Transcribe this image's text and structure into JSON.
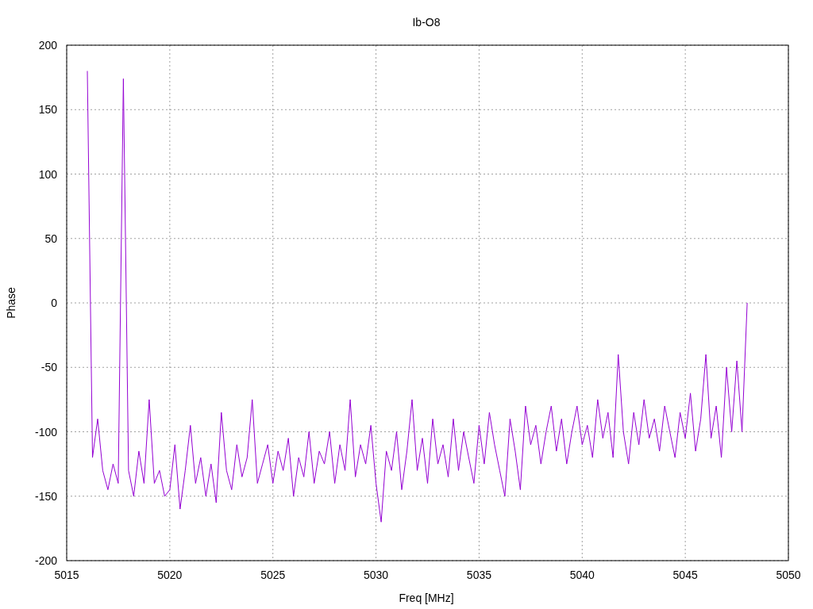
{
  "chart_data": {
    "type": "line",
    "title": "Ib-O8",
    "xlabel": "Freq [MHz]",
    "ylabel": "Phase",
    "x": [
      5016,
      5016.25,
      5016.5,
      5016.75,
      5017,
      5017.25,
      5017.5,
      5017.75,
      5018,
      5018.25,
      5018.5,
      5018.75,
      5019,
      5019.25,
      5019.5,
      5019.75,
      5020,
      5020.25,
      5020.5,
      5020.75,
      5021,
      5021.25,
      5021.5,
      5021.75,
      5022,
      5022.25,
      5022.5,
      5022.75,
      5023,
      5023.25,
      5023.5,
      5023.75,
      5024,
      5024.25,
      5024.5,
      5024.75,
      5025,
      5025.25,
      5025.5,
      5025.75,
      5026,
      5026.25,
      5026.5,
      5026.75,
      5027,
      5027.25,
      5027.5,
      5027.75,
      5028,
      5028.25,
      5028.5,
      5028.75,
      5029,
      5029.25,
      5029.5,
      5029.75,
      5030,
      5030.25,
      5030.5,
      5030.75,
      5031,
      5031.25,
      5031.5,
      5031.75,
      5032,
      5032.25,
      5032.5,
      5032.75,
      5033,
      5033.25,
      5033.5,
      5033.75,
      5034,
      5034.25,
      5034.5,
      5034.75,
      5035,
      5035.25,
      5035.5,
      5035.75,
      5036,
      5036.25,
      5036.5,
      5036.75,
      5037,
      5037.25,
      5037.5,
      5037.75,
      5038,
      5038.25,
      5038.5,
      5038.75,
      5039,
      5039.25,
      5039.5,
      5039.75,
      5040,
      5040.25,
      5040.5,
      5040.75,
      5041,
      5041.25,
      5041.5,
      5041.75,
      5042,
      5042.25,
      5042.5,
      5042.75,
      5043,
      5043.25,
      5043.5,
      5043.75,
      5044,
      5044.25,
      5044.5,
      5044.75,
      5045,
      5045.25,
      5045.5,
      5045.75,
      5046,
      5046.25,
      5046.5,
      5046.75,
      5047,
      5047.25,
      5047.5,
      5047.75,
      5048
    ],
    "series": [
      {
        "color": "#9400d3",
        "values": [
          180,
          -120,
          -90,
          -130,
          -145,
          -125,
          -140,
          174,
          -130,
          -150,
          -115,
          -140,
          -75,
          -140,
          -130,
          -150,
          -145,
          -110,
          -160,
          -130,
          -95,
          -140,
          -120,
          -150,
          -125,
          -155,
          -85,
          -130,
          -145,
          -110,
          -135,
          -120,
          -75,
          -140,
          -125,
          -110,
          -140,
          -115,
          -130,
          -105,
          -150,
          -120,
          -135,
          -100,
          -140,
          -115,
          -125,
          -100,
          -140,
          -110,
          -130,
          -75,
          -135,
          -110,
          -125,
          -95,
          -140,
          -170,
          -115,
          -130,
          -100,
          -145,
          -115,
          -75,
          -130,
          -105,
          -140,
          -90,
          -125,
          -110,
          -135,
          -90,
          -130,
          -100,
          -120,
          -140,
          -95,
          -125,
          -85,
          -110,
          -130,
          -150,
          -90,
          -115,
          -145,
          -80,
          -110,
          -95,
          -125,
          -100,
          -80,
          -115,
          -90,
          -125,
          -100,
          -80,
          -110,
          -95,
          -120,
          -75,
          -105,
          -85,
          -120,
          -40,
          -100,
          -125,
          -85,
          -110,
          -75,
          -105,
          -90,
          -115,
          -80,
          -100,
          -120,
          -85,
          -105,
          -70,
          -115,
          -90,
          -40,
          -105,
          -80,
          -120,
          -50,
          -100,
          -45,
          -100,
          0
        ]
      }
    ],
    "grid": true,
    "xlim": [
      5015,
      5050
    ],
    "ylim": [
      -200,
      200
    ],
    "xticks": [
      5015,
      5020,
      5025,
      5030,
      5035,
      5040,
      5045,
      5050
    ],
    "yticks": [
      -200,
      -150,
      -100,
      -50,
      0,
      50,
      100,
      150,
      200
    ]
  }
}
